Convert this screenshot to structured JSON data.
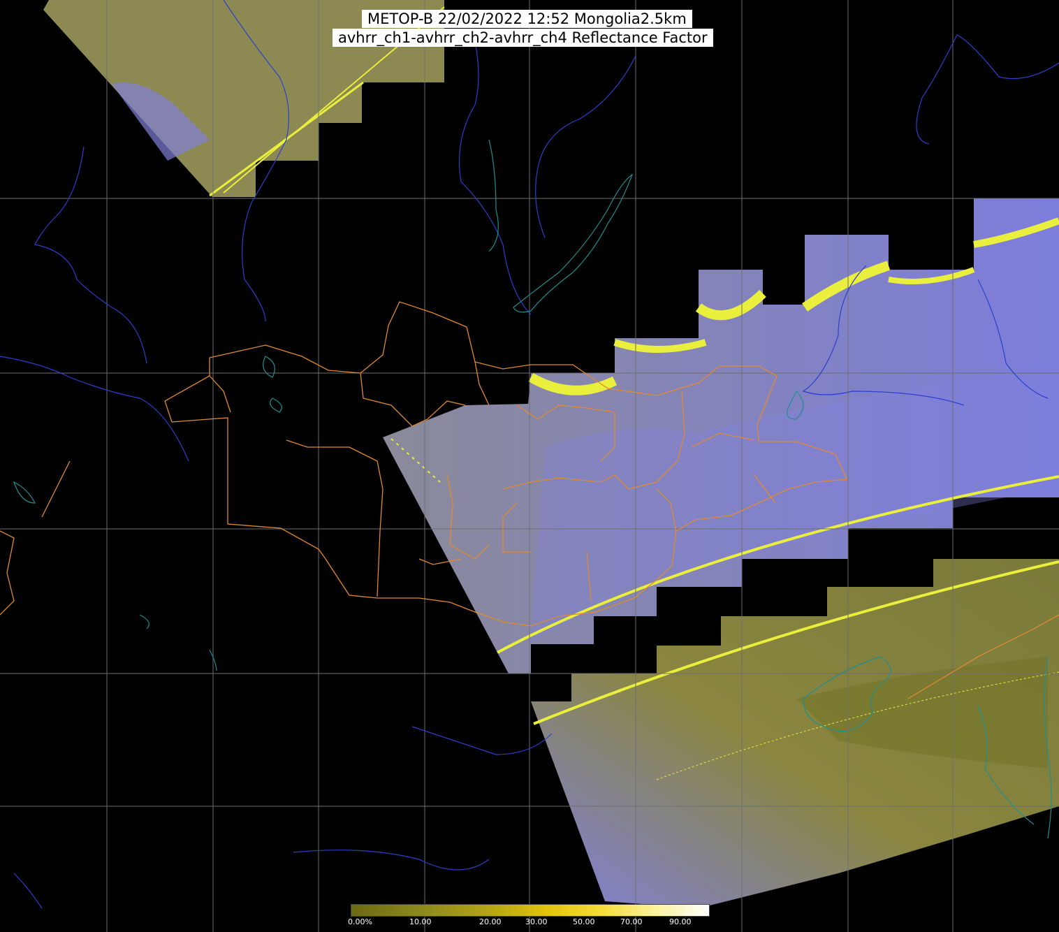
{
  "header": {
    "title_line1": "METOP-B 22/02/2022 12:52 Mongolia2.5km",
    "title_line2": "avhrr_ch1-avhrr_ch2-avhrr_ch4 Reflectance Factor"
  },
  "colorbar": {
    "labels": [
      "0.00%",
      "10.00",
      "20.00",
      "30.00",
      "50.00",
      "70.00",
      "90.00"
    ],
    "colors": [
      "#6b6a12",
      "#8d8a1c",
      "#b8a615",
      "#e2c40f",
      "#f5dc3a",
      "#fbf29a",
      "#ffffff"
    ]
  },
  "map": {
    "background": "#000000",
    "graticule_color": "#6e6e6e",
    "coastline_color": "#1f8f8f",
    "river_color": "#2c3fcf",
    "border_color": "#e08a30",
    "swath_olive": "#8c8a50",
    "swath_lavender": "#7f7fdc",
    "scanline_color": "#e9ef3c"
  }
}
